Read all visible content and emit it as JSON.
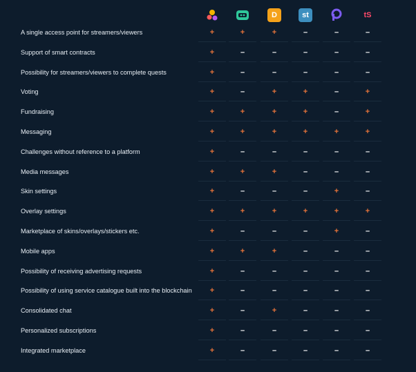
{
  "platforms": [
    {
      "icon": "dots-cluster-icon",
      "text": "",
      "color": "#f5b400",
      "bg": "transparent"
    },
    {
      "icon": "robot-face-icon",
      "text": "",
      "color": "#2fc79a",
      "bg": "#2fc79a"
    },
    {
      "icon": "d-logo-icon",
      "text": "D",
      "color": "#ffffff",
      "bg": "#f5a21a"
    },
    {
      "icon": "st-logo-icon",
      "text": "st",
      "color": "#ffffff",
      "bg": "#3d8fbf"
    },
    {
      "icon": "p-logo-icon",
      "text": "P",
      "color": "#7c5cf0",
      "bg": "transparent"
    },
    {
      "icon": "ts-logo-icon",
      "text": "tS",
      "color": "#ff4a6a",
      "bg": "transparent"
    }
  ],
  "rows": [
    {
      "label": "A single access point for streamers/viewers",
      "values": [
        "+",
        "+",
        "+",
        "-",
        "-",
        "-"
      ]
    },
    {
      "label": "Support of smart contracts",
      "values": [
        "+",
        "-",
        "-",
        "-",
        "-",
        "-"
      ]
    },
    {
      "label": "Possibility for streamers/viewers to complete quests",
      "values": [
        "+",
        "-",
        "-",
        "-",
        "-",
        "-"
      ]
    },
    {
      "label": "Voting",
      "values": [
        "+",
        "-",
        "+",
        "+",
        "-",
        "+"
      ]
    },
    {
      "label": "Fundraising",
      "values": [
        "+",
        "+",
        "+",
        "+",
        "-",
        "+"
      ]
    },
    {
      "label": "Messaging",
      "values": [
        "+",
        "+",
        "+",
        "+",
        "+",
        "+"
      ]
    },
    {
      "label": "Challenges without reference to a platform",
      "values": [
        "+",
        "-",
        "-",
        "-",
        "-",
        "-"
      ]
    },
    {
      "label": "Media messages",
      "values": [
        "+",
        "+",
        "+",
        "-",
        "-",
        "-"
      ]
    },
    {
      "label": "Skin settings",
      "values": [
        "+",
        "-",
        "-",
        "-",
        "+",
        "-"
      ]
    },
    {
      "label": "Overlay settings",
      "values": [
        "+",
        "+",
        "+",
        "+",
        "+",
        "+"
      ]
    },
    {
      "label": "Marketplace of skins/overlays/stickers etc.",
      "values": [
        "+",
        "-",
        "-",
        "-",
        "+",
        "-"
      ]
    },
    {
      "label": "Mobile apps",
      "values": [
        "+",
        "+",
        "+",
        "-",
        "-",
        "-"
      ]
    },
    {
      "label": "Possibility of receiving advertising requests",
      "values": [
        "+",
        "-",
        "-",
        "-",
        "-",
        "-"
      ]
    },
    {
      "label": "Possibility of using service catalogue built into the blockchain",
      "values": [
        "+",
        "-",
        "-",
        "-",
        "-",
        "-"
      ]
    },
    {
      "label": "Consolidated chat",
      "values": [
        "+",
        "-",
        "+",
        "-",
        "-",
        "-"
      ]
    },
    {
      "label": "Personalized subscriptions",
      "values": [
        "+",
        "-",
        "-",
        "-",
        "-",
        "-"
      ]
    },
    {
      "label": "Integrated marketplace",
      "values": [
        "+",
        "-",
        "-",
        "-",
        "-",
        "-"
      ]
    }
  ]
}
